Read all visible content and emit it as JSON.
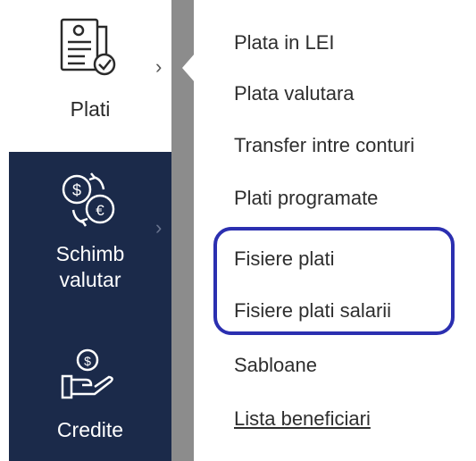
{
  "nav": {
    "plati": {
      "label": "Plati",
      "icon": "invoice-check-icon",
      "chevron": "chevron-right-icon"
    },
    "schimb": {
      "label_line1": "Schimb",
      "label_line2": "valutar",
      "icon": "currency-exchange-icon",
      "chevron": "chevron-right-icon"
    },
    "credite": {
      "label": "Credite",
      "icon": "hand-coin-icon"
    }
  },
  "submenu": {
    "items": [
      {
        "label": "Plata in LEI"
      },
      {
        "label": "Plata valutara"
      },
      {
        "label": "Transfer intre conturi"
      },
      {
        "label": "Plati programate"
      },
      {
        "label": "Fisiere plati"
      },
      {
        "label": "Fisiere plati salarii"
      },
      {
        "label": "Sabloane"
      },
      {
        "label": "Lista beneficiari"
      }
    ]
  },
  "colors": {
    "nav_dark": "#1b2a4a",
    "divider": "#8c8c8c",
    "highlight": "#2b2fb0"
  }
}
